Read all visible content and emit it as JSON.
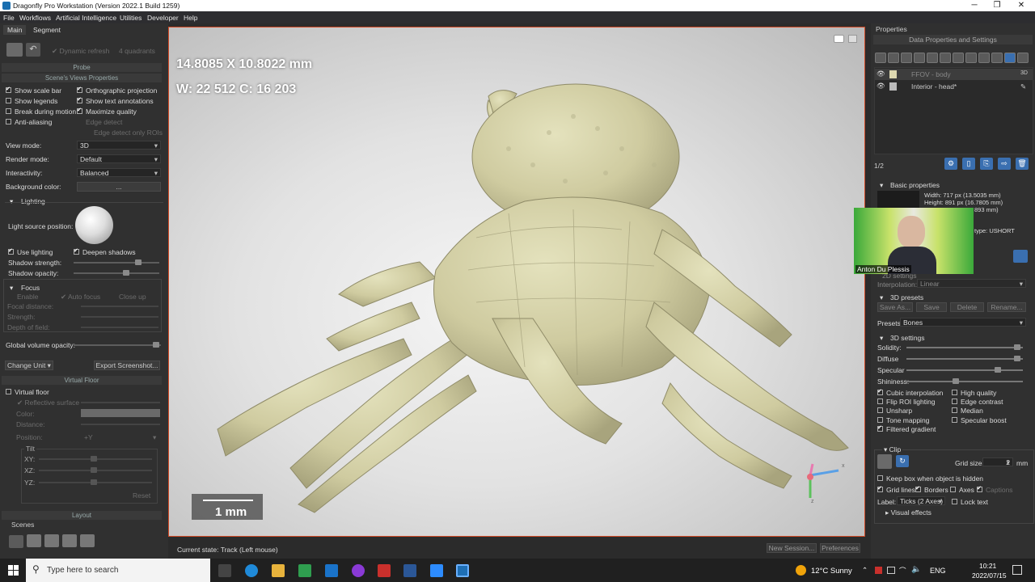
{
  "window": {
    "title": "Dragonfly Pro Workstation (Version 2022.1 Build 1259)"
  },
  "menu": [
    "File",
    "Workflows",
    "Artificial Intelligence",
    "Utilities",
    "Developer",
    "Help"
  ],
  "left": {
    "tabs": [
      "Main",
      "Segment"
    ],
    "top_toolbar": {
      "dynamic_refresh": "Dynamic refresh",
      "quadrants": "4 quadrants"
    },
    "probe": "Probe",
    "scene_views": "Scene's Views Properties",
    "checks": {
      "show_scale_bar": "Show scale bar",
      "show_legends": "Show legends",
      "break_during_motion": "Break during motion",
      "anti_aliasing": "Anti-aliasing",
      "orthographic_projection": "Orthographic projection",
      "show_text_annotations": "Show text annotations",
      "maximize_quality": "Maximize quality",
      "edge_detect": "Edge detect",
      "edge_detect_only_rois": "Edge detect only ROIs"
    },
    "view_mode": {
      "label": "View mode:",
      "value": "3D"
    },
    "render_mode": {
      "label": "Render mode:",
      "value": "Default"
    },
    "interactivity": {
      "label": "Interactivity:",
      "value": "Balanced"
    },
    "background_color": {
      "label": "Background color:",
      "value": "..."
    },
    "lighting": {
      "header": "Lighting",
      "light_source_position": "Light source position:",
      "use_lighting": "Use lighting",
      "deepen_shadows": "Deepen shadows",
      "shadow_strength": "Shadow strength:",
      "shadow_opacity": "Shadow opacity:",
      "shadow_strength_level": 0.78,
      "shadow_opacity_level": 0.62
    },
    "focus": {
      "header": "Focus",
      "enable": "Enable",
      "auto_focus": "Auto focus",
      "close_up": "Close up",
      "focal_distance": "Focal distance:",
      "strength": "Strength:",
      "depth_of_field": "Depth of field:"
    },
    "global_volume_opacity": {
      "label": "Global volume opacity:",
      "level": 0.98
    },
    "change_unit": "Change Unit",
    "export_screenshot": "Export Screenshot...",
    "virtual_floor": {
      "header": "Virtual Floor",
      "checkbox": "Virtual floor",
      "reflective_surface": "Reflective surface",
      "color": "Color:",
      "distance": "Distance:",
      "position": "Position:",
      "position_value": "+Y",
      "tilt": "Tilt",
      "xy": "XY:",
      "xz": "XZ:",
      "yz": "YZ:",
      "reset": "Reset"
    },
    "layout": "Layout",
    "scenes": "Scenes"
  },
  "viewport": {
    "dimensions": "14.8085 X 10.8022 mm",
    "wc": "W: 22 512 C: 16 203",
    "scale": "1 mm",
    "axis_x": "x",
    "axis_z": "z"
  },
  "status": {
    "current_state": "Current state: Track (Left mouse)",
    "new_session": "New Session...",
    "preferences": "Preferences"
  },
  "right": {
    "properties": "Properties",
    "data_props": "Data Properties and Settings",
    "layers": [
      {
        "name": "FFOV - body",
        "tag": "3D"
      },
      {
        "name": "Interior - head*",
        "tag": "✎"
      }
    ],
    "page": "1/2",
    "basic_props": "Basic properties",
    "info": {
      "width": "Width: 717 px (13.5035 mm)",
      "height": "Height: 891 px (16.7805 mm)",
      "depth": "893 mm)",
      "type": "type: USHORT"
    },
    "webcam_name": "Anton Du Plessis",
    "settings_2d": "2D settings",
    "interpolation": {
      "label": "Interpolation:",
      "value": "Linear"
    },
    "presets3d": {
      "header": "3D presets",
      "save_as": "Save As...",
      "save": "Save",
      "delete": "Delete",
      "rename": "Rename...",
      "presets_label": "Presets",
      "presets_value": "Bones"
    },
    "settings3d": {
      "header": "3D settings",
      "solidity": "Solidity:",
      "diffuse": "Diffuse",
      "specular": "Specular",
      "shininess": "Shininess:",
      "solidity_level": 0.98,
      "diffuse_level": 0.98,
      "specular_level": 0.8,
      "shininess_level": 0.42
    },
    "opts": {
      "cubic": "Cubic interpolation",
      "flip_roi": "Flip ROI lighting",
      "unsharp": "Unsharp",
      "tone_mapping": "Tone mapping",
      "filtered_gradient": "Filtered gradient",
      "high_quality": "High quality",
      "edge_contrast": "Edge contrast",
      "median": "Median",
      "specular_boost": "Specular boost"
    },
    "clip": {
      "header": "Clip",
      "grid_size_label": "Grid size:",
      "grid_size_value": "2",
      "grid_size_unit": "mm",
      "keep_box": "Keep box when object is hidden",
      "grid_lines": "Grid lines",
      "borders": "Borders",
      "axes": "Axes",
      "captions": "Captions",
      "label": "Label:",
      "label_value": "Ticks (2 Axes)",
      "lock_text": "Lock text",
      "visual_effects": "Visual effects"
    }
  },
  "taskbar": {
    "search": "Type here to search",
    "weather": "12°C  Sunny",
    "lang": "ENG",
    "time": "10:21",
    "date": "2022/07/15"
  },
  "colors": {
    "accent": "#3a6fb0",
    "viewport_border": "#d24a26",
    "specimen": "#d8d6b0",
    "panel": "#303030"
  }
}
